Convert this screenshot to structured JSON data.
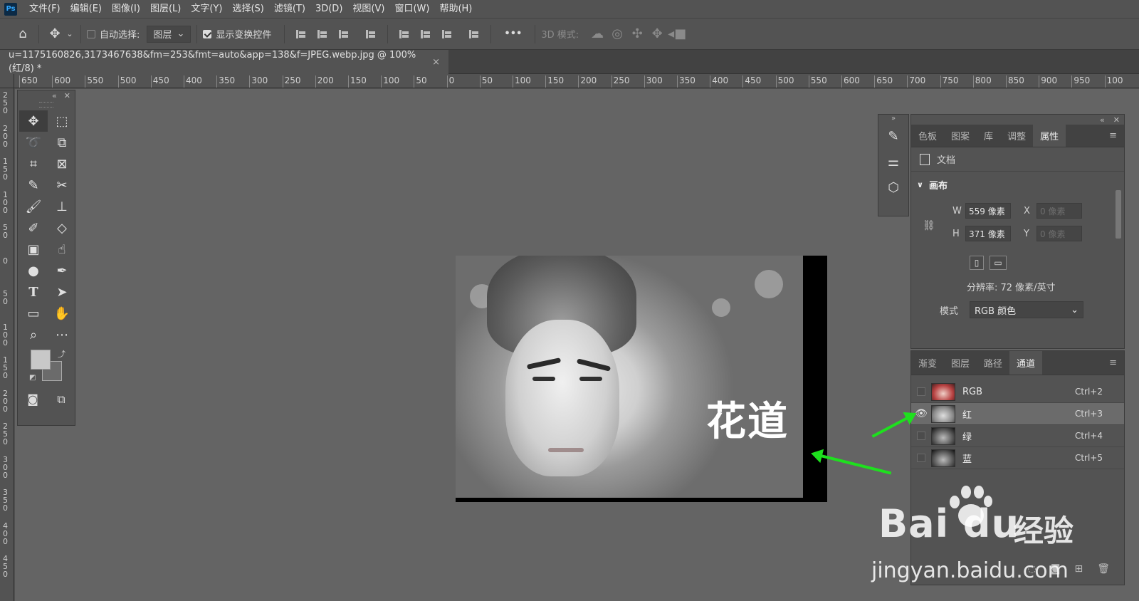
{
  "app": {
    "logo": "Ps",
    "menu": [
      "文件(F)",
      "编辑(E)",
      "图像(I)",
      "图层(L)",
      "文字(Y)",
      "选择(S)",
      "滤镜(T)",
      "3D(D)",
      "视图(V)",
      "窗口(W)",
      "帮助(H)"
    ]
  },
  "options": {
    "auto_select_label": "自动选择:",
    "auto_select_value": "图层",
    "show_transform_label": "显示变换控件",
    "more": "•••",
    "mode_3d_label": "3D 模式:"
  },
  "document": {
    "tab_title": "u=1175160826,3173467638&fm=253&fmt=auto&app=138&f=JPEG.webp.jpg @ 100%(红/8) *",
    "close": "×"
  },
  "ruler": {
    "top_ticks": [
      "650",
      "600",
      "550",
      "500",
      "450",
      "400",
      "350",
      "300",
      "250",
      "200",
      "150",
      "100",
      "50",
      "0",
      "50",
      "100",
      "150",
      "200",
      "250",
      "300",
      "350",
      "400",
      "450",
      "500",
      "550",
      "600",
      "650",
      "700",
      "750",
      "800",
      "850",
      "900",
      "950",
      "100"
    ],
    "left_ticks": [
      "2 5 0",
      "2 0 0",
      "1 5 0",
      "1 0 0",
      "5 0",
      "0",
      "5 0",
      "1 0 0",
      "1 5 0",
      "2 0 0",
      "2 5 0",
      "3 0 0",
      "3 5 0",
      "4 0 0",
      "4 5 0"
    ]
  },
  "image": {
    "overlay_text": "花道"
  },
  "properties": {
    "tabs": [
      "色板",
      "图案",
      "库",
      "调整",
      "属性"
    ],
    "active_tab": "属性",
    "doc_label": "文档",
    "section": "画布",
    "w_label": "W",
    "w_value": "559 像素",
    "h_label": "H",
    "h_value": "371 像素",
    "x_label": "X",
    "x_value": "0 像素",
    "y_label": "Y",
    "y_value": "0 像素",
    "resolution": "分辨率: 72 像素/英寸",
    "mode_label": "模式",
    "mode_value": "RGB 颜色"
  },
  "channels": {
    "tabs": [
      "渐变",
      "图层",
      "路径",
      "通道"
    ],
    "active_tab": "通道",
    "rows": [
      {
        "name": "RGB",
        "shortcut": "Ctrl+2"
      },
      {
        "name": "红",
        "shortcut": "Ctrl+3"
      },
      {
        "name": "绿",
        "shortcut": "Ctrl+4"
      },
      {
        "name": "蓝",
        "shortcut": "Ctrl+5"
      }
    ]
  },
  "watermark": {
    "brand": "Bai du",
    "cn": "经验",
    "url": "jingyan.baidu.com"
  },
  "colors": {
    "accent_arrow": "#1ee01e",
    "ps_blue": "#31a8ff"
  }
}
